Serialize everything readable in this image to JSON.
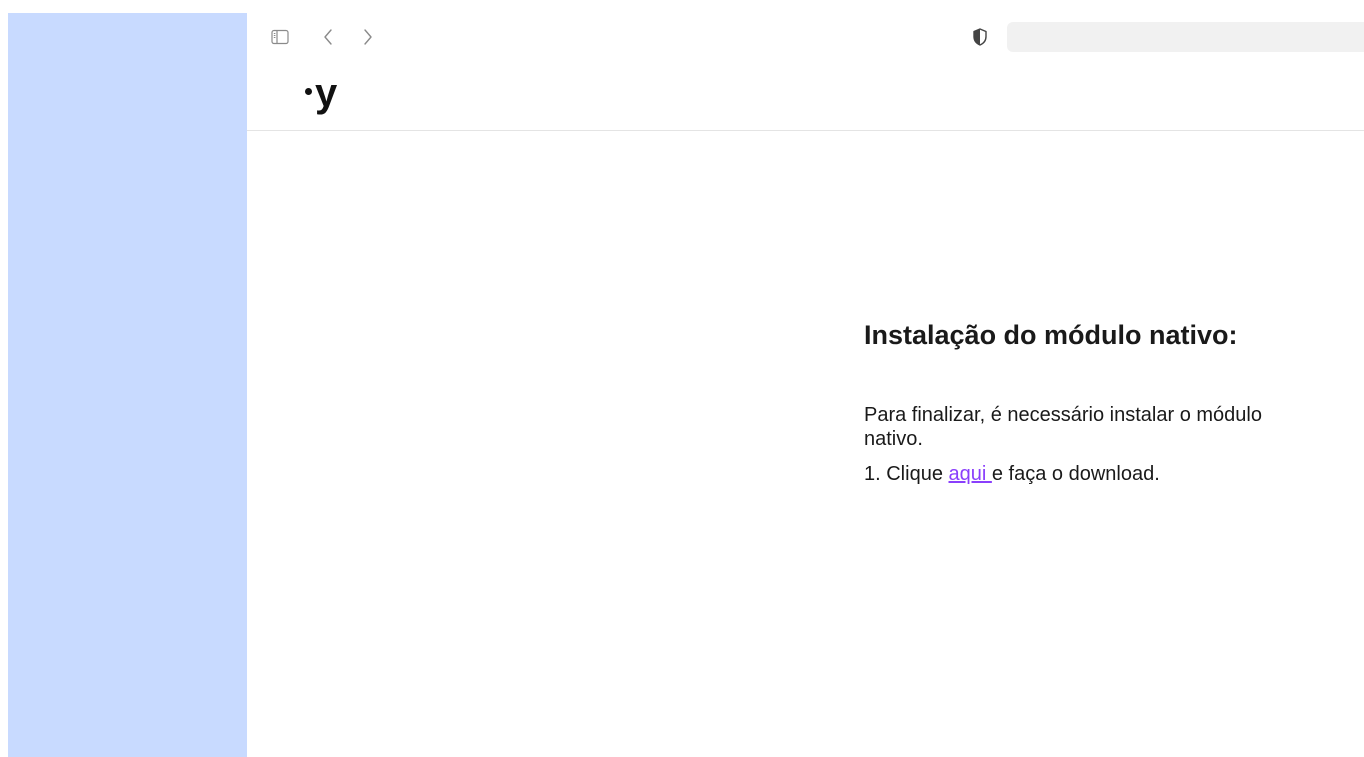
{
  "toolbar": {
    "icons": {
      "sidebar_toggle": "sidebar-toggle-icon",
      "back": "chevron-left-icon",
      "forward": "chevron-right-icon",
      "privacy": "shield-icon"
    },
    "address_value": ""
  },
  "header": {
    "logo_text": "y"
  },
  "main": {
    "title": "Instalação do módulo nativo:",
    "intro": "Para finalizar, é necessário instalar o módulo nativo.",
    "step1": {
      "prefix": "1. Clique ",
      "link_label": "aqui ",
      "suffix": "e faça o download."
    }
  },
  "colors": {
    "sidebar_bg": "#c8daff",
    "link": "#8a3ffc",
    "text": "#1a1a1a"
  }
}
